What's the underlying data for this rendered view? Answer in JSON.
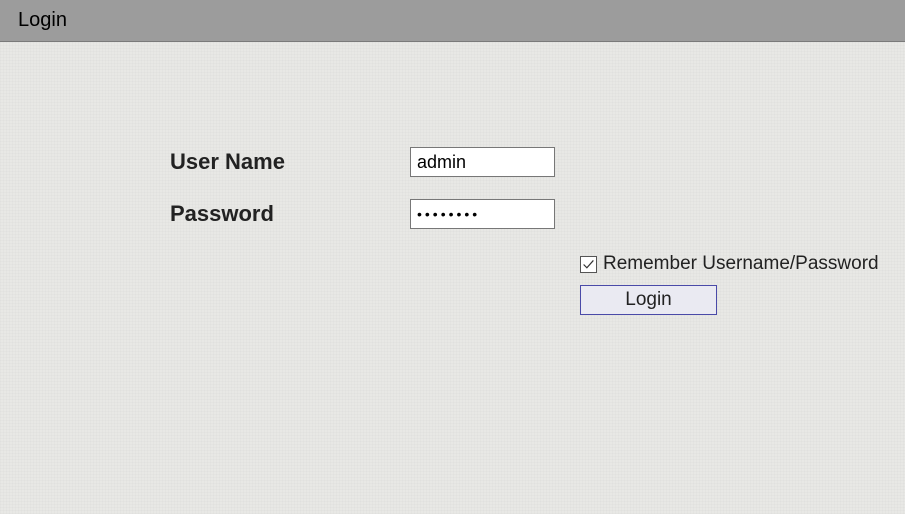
{
  "header": {
    "title": "Login"
  },
  "form": {
    "username_label": "User Name",
    "username_value": "admin",
    "password_label": "Password",
    "password_value": "••••••••",
    "remember_label": "Remember Username/Password",
    "remember_checked": true,
    "login_button_label": "Login"
  }
}
